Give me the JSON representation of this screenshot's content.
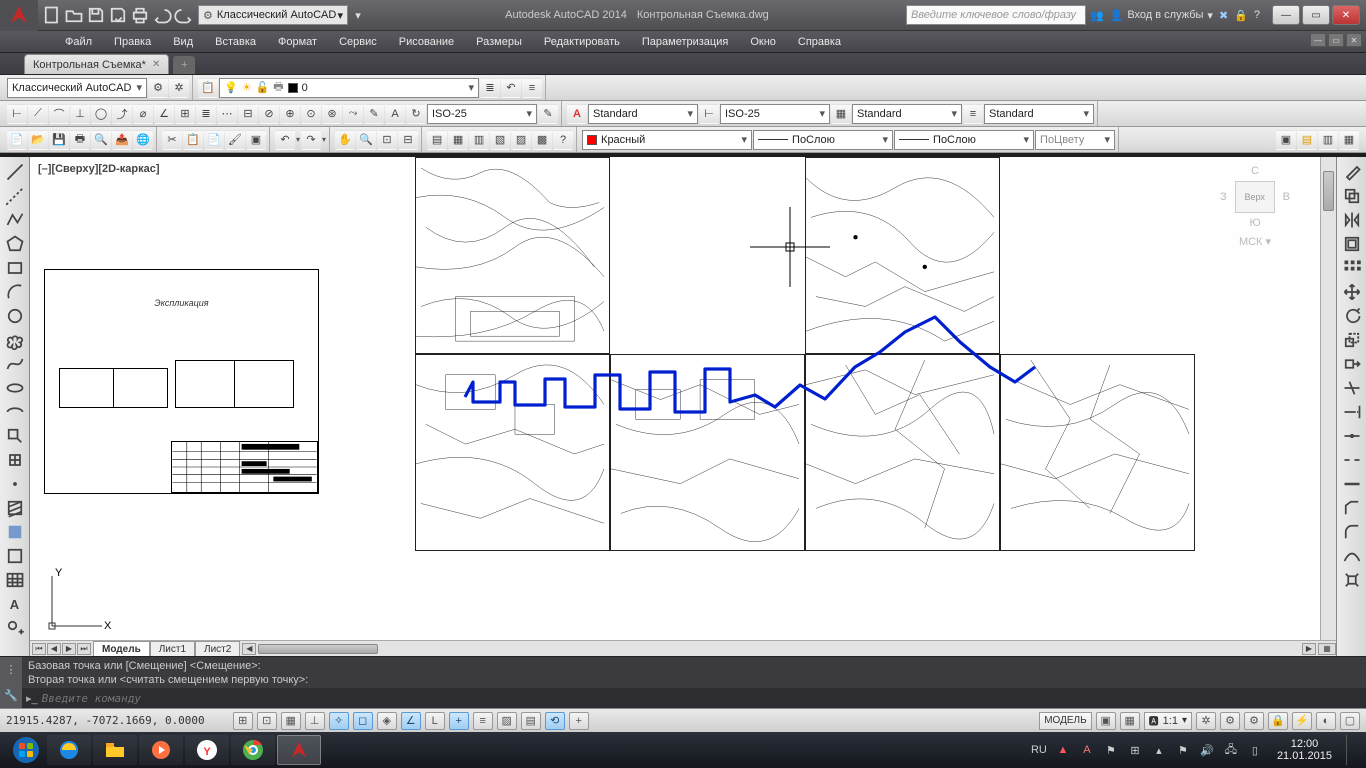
{
  "title": {
    "app": "Autodesk AutoCAD 2014",
    "doc": "Контрольная Съемка.dwg"
  },
  "workspace_selector": "Классический AutoCAD",
  "search_placeholder": "Введите ключевое слово/фразу",
  "signin_label": "Вход в службы",
  "menu": [
    "Файл",
    "Правка",
    "Вид",
    "Вставка",
    "Формат",
    "Сервис",
    "Рисование",
    "Размеры",
    "Редактировать",
    "Параметризация",
    "Окно",
    "Справка"
  ],
  "doc_tab": "Контрольная Съемка*",
  "row1": {
    "workspace": "Классический AutoCAD",
    "layer": "0"
  },
  "row2": {
    "dimstyle": "ISO-25",
    "textstyle": "Standard",
    "dimstyle2": "ISO-25",
    "tablestyle": "Standard",
    "mlstyle": "Standard"
  },
  "row3": {
    "color": "Красный",
    "linetype": "ПоСлою",
    "lineweight": "ПоСлою",
    "plotstyle": "ПоЦвету"
  },
  "viewport_label": "[–][Сверху][2D-каркас]",
  "viewcube": {
    "face": "Верх",
    "s": "З",
    "e": "В",
    "n": "С",
    "so": "Ю",
    "wcs": "МСК"
  },
  "layout_tabs": [
    "Модель",
    "Лист1",
    "Лист2"
  ],
  "cmd_history": [
    "Базовая точка или [Смещение] <Смещение>:",
    "Вторая точка или <считать смещением первую точку>:"
  ],
  "cmd_placeholder": "Введите команду",
  "status": {
    "coords": "21915.4287, -7072.1669, 0.0000",
    "model": "МОДЕЛЬ",
    "scale": "1:1"
  },
  "taskbar": {
    "lang": "RU",
    "time": "12:00",
    "date": "21.01.2015"
  },
  "legend_title": "Экспликация"
}
